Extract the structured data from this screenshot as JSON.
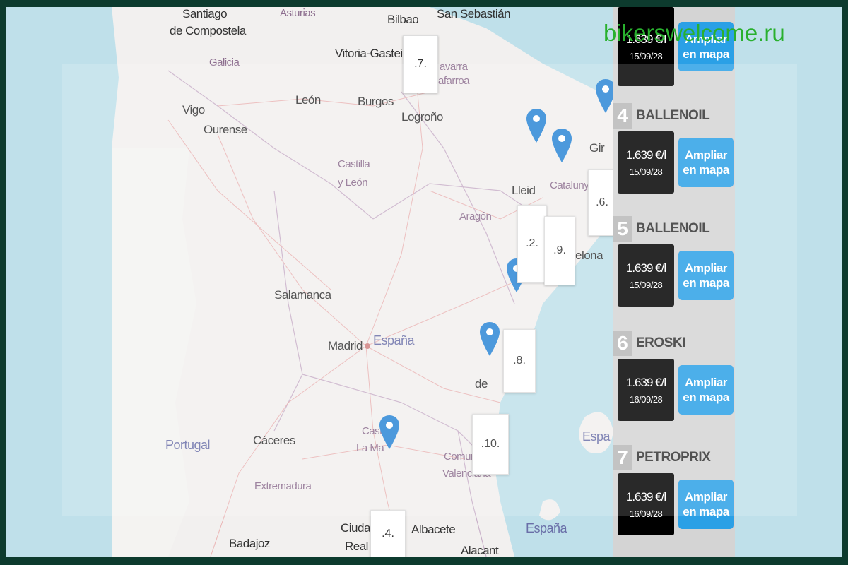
{
  "watermark": "bikerswelcome.ru",
  "colors": {
    "pin": "#2a86d6",
    "map_button": "#2aa0e6",
    "price_box": "#000000",
    "watermark": "#29b02e",
    "sea": "#bfe0ea",
    "land": "#f2f0ef"
  },
  "map": {
    "labels": {
      "santiago": "Santiago",
      "compostela": "de Compostela",
      "asturias": "Asturias",
      "bilbao": "Bilbao",
      "san_sebastian": "San Sebastián",
      "galicia": "Galicia",
      "vitoria": "Vitoria-Gasteiz",
      "navarra1": "avarra",
      "navarra2": "afarroa",
      "leon": "León",
      "burgos": "Burgos",
      "vigo": "Vigo",
      "ourense": "Ourense",
      "logrono": "Logroño",
      "castilla1": "Castilla",
      "castilla2": "y León",
      "lleida": "Lleid",
      "catalunya": "Catalunya",
      "girona": "Gir",
      "aragon": "Aragón",
      "barcelona": "elona",
      "salamanca": "Salamanca",
      "madrid": "Madrid",
      "espana": "España",
      "valencia_city": "de",
      "portugal": "Portugal",
      "caceres": "Cáceres",
      "castilla_mancha1": "Cast",
      "castilla_mancha2": "La Ma",
      "comunitat1": "Comun",
      "comunitat2": "Valenciana",
      "extremadura": "Extremadura",
      "espana_islands1": "Espa",
      "espana_islands2": "España",
      "ciudad_real1": "Ciudad",
      "ciudad_real2": "Real",
      "albacete": "Albacete",
      "badajoz": "Badajoz",
      "alacant": "Alacant"
    },
    "number_boxes": [
      ".7.",
      ".2.",
      ".9.",
      ".6.",
      ".8.",
      ".10.",
      ".4."
    ]
  },
  "stations": [
    {
      "number": "",
      "name": "",
      "price": "1.639 €/l",
      "date": "15/09/28",
      "button": "Ampliar en mapa"
    },
    {
      "number": "4",
      "name": "BALLENOIL",
      "price": "1.639 €/l",
      "date": "15/09/28",
      "button": "Ampliar en mapa"
    },
    {
      "number": "5",
      "name": "BALLENOIL",
      "price": "1.639 €/l",
      "date": "15/09/28",
      "button": "Ampliar en mapa"
    },
    {
      "number": "6",
      "name": "EROSKI",
      "price": "1.639 €/l",
      "date": "16/09/28",
      "button": "Ampliar en mapa"
    },
    {
      "number": "7",
      "name": "PETROPRIX",
      "price": "1.639 €/l",
      "date": "16/09/28",
      "button": "Ampliar en mapa"
    }
  ]
}
